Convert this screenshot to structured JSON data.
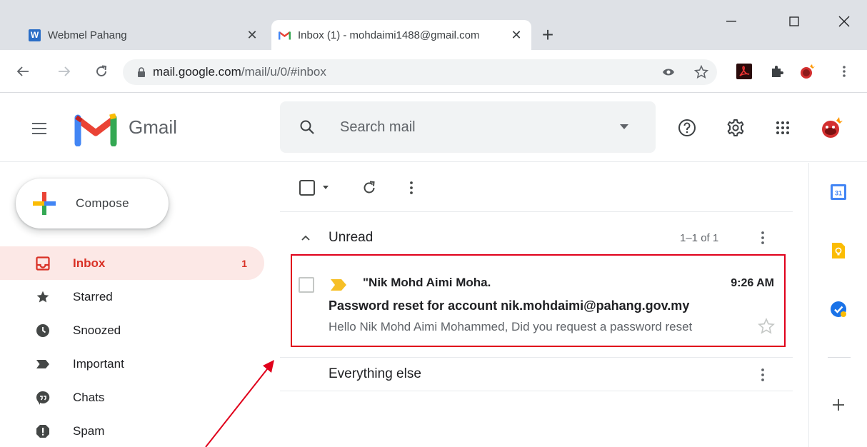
{
  "browser": {
    "tabs": [
      {
        "title": "Webmel Pahang",
        "favicon": "webmel-w-icon",
        "favicon_letter": "W",
        "active": false,
        "close": "✕"
      },
      {
        "title": "Inbox (1) - mohdaimi1488@gmail.com",
        "favicon": "gmail-icon",
        "active": true,
        "close": "✕"
      }
    ],
    "new_tab": "+",
    "address": {
      "host": "mail.google.com",
      "path": "/mail/u/0/#inbox"
    }
  },
  "app": {
    "brand": "Gmail",
    "search": {
      "placeholder": "Search mail"
    }
  },
  "compose": {
    "label": "Compose"
  },
  "nav": [
    {
      "label": "Inbox",
      "icon": "inbox-icon",
      "count": "1",
      "active": true
    },
    {
      "label": "Starred",
      "icon": "star-icon",
      "count": "",
      "active": false
    },
    {
      "label": "Snoozed",
      "icon": "clock-icon",
      "count": "",
      "active": false
    },
    {
      "label": "Important",
      "icon": "important-icon",
      "count": "",
      "active": false
    },
    {
      "label": "Chats",
      "icon": "chat-icon",
      "count": "",
      "active": false
    },
    {
      "label": "Spam",
      "icon": "spam-icon",
      "count": "",
      "active": false
    }
  ],
  "list": {
    "unread": {
      "title": "Unread",
      "count": "1–1 of 1"
    },
    "everything_else": {
      "title": "Everything else"
    },
    "email": {
      "sender": "\"Nik Mohd Aimi Moha.",
      "time": "9:26 AM",
      "subject": "Password reset for account nik.mohdaimi@pahang.gov.my",
      "snippet": "Hello Nik Mohd Aimi Mohammed, Did you request a password reset"
    }
  },
  "colors": {
    "accent_red": "#d93025",
    "active_nav_bg": "#fce8e6",
    "annotation_red": "#e0001b",
    "important_marker": "#f6bf26"
  }
}
